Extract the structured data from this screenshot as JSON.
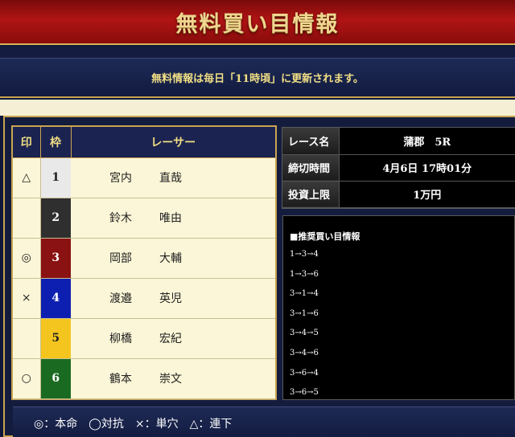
{
  "header": {
    "title": "無料買い目情報"
  },
  "notice": {
    "text": "無料情報は毎日「11時頃」に更新されます。"
  },
  "racers_table": {
    "headers": {
      "mark": "印",
      "waku": "枠",
      "racer": "レーサー"
    },
    "rows": [
      {
        "mark": "△",
        "waku": "1",
        "last": "宮内",
        "first": "直哉",
        "waku_color": "#e9e9e9",
        "waku_text_color": "#222222"
      },
      {
        "mark": "",
        "waku": "2",
        "last": "鈴木",
        "first": "唯由",
        "waku_color": "#2f2f2f",
        "waku_text_color": "#ffffff"
      },
      {
        "mark": "◎",
        "waku": "3",
        "last": "岡部",
        "first": "大輔",
        "waku_color": "#8a1212",
        "waku_text_color": "#ffffff"
      },
      {
        "mark": "×",
        "waku": "4",
        "last": "渡邉",
        "first": "英児",
        "waku_color": "#0d1fb0",
        "waku_text_color": "#ffffff"
      },
      {
        "mark": "",
        "waku": "5",
        "last": "柳橋",
        "first": "宏紀",
        "waku_color": "#f4c51e",
        "waku_text_color": "#222222"
      },
      {
        "mark": "○",
        "waku": "6",
        "last": "鶴本",
        "first": "崇文",
        "waku_color": "#1b6a22",
        "waku_text_color": "#ffffff"
      }
    ]
  },
  "race_info": {
    "race_name_label": "レース名",
    "race_name_value": "蒲郡　5R",
    "deadline_label": "締切時間",
    "deadline_value": "4月6日 17時01分",
    "limit_label": "投資上限",
    "limit_value": "1万円"
  },
  "recommendations": {
    "title": "■推奨買い目情報",
    "items": [
      "1→3→4",
      "1→3→6",
      "3→1→4",
      "3→1→6",
      "3→4→5",
      "3→4→6",
      "3→6→4",
      "3→6→5"
    ]
  },
  "legend": {
    "text": "◎：本命　◯対抗　×：単穴　△：連下"
  }
}
